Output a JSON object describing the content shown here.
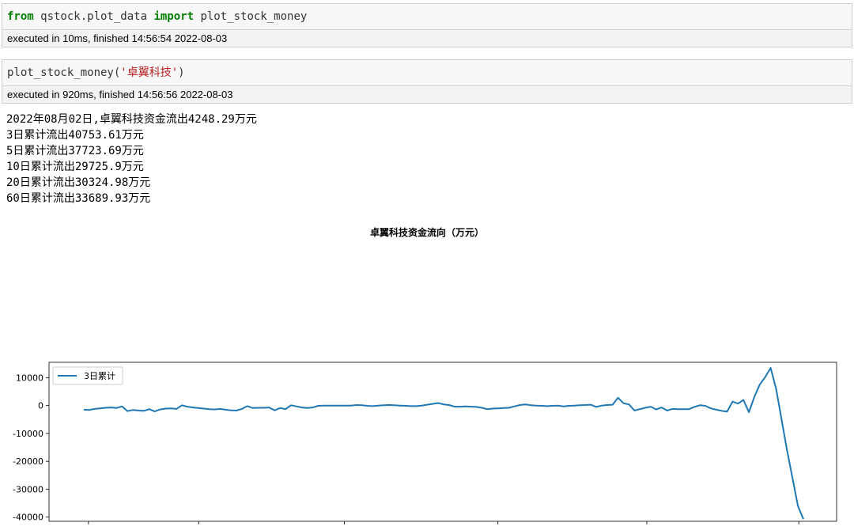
{
  "cells": [
    {
      "code_kw1": "from",
      "code_mod": " qstock.plot_data ",
      "code_kw2": "import",
      "code_rest": " plot_stock_money",
      "exec_text": "executed in 10ms, finished 14:56:54 2022-08-03"
    },
    {
      "code_fn": "plot_stock_money(",
      "code_str": "'卓翼科技'",
      "code_close": ")",
      "exec_text": "executed in 920ms, finished 14:56:56 2022-08-03"
    }
  ],
  "output_lines": [
    "2022年08月02日,卓翼科技资金流出4248.29万元",
    "3日累计流出40753.61万元",
    "5日累计流出37723.69万元",
    "10日累计流出29725.9万元",
    "20日累计流出30324.98万元",
    "60日累计流出33689.93万元"
  ],
  "colors": {
    "line": "#1f77b4",
    "keyword": "#008000",
    "string": "#ba2121"
  },
  "chart_data": {
    "type": "line",
    "title": "卓翼科技资金流向（万元）",
    "xlabel": "",
    "ylabel": "",
    "ylim": [
      -41500,
      15500
    ],
    "yticks": [
      10000,
      0,
      -10000,
      -20000,
      -30000,
      -40000
    ],
    "ytick_labels": [
      "10000",
      "0",
      "-10000",
      "-20000",
      "-30000",
      "-40000"
    ],
    "grid": false,
    "legend_position": "top-left",
    "series": [
      {
        "name": "3日累计",
        "values": [
          -1500,
          -1600,
          -1200,
          -1000,
          -800,
          -700,
          -900,
          -300,
          -2000,
          -1600,
          -1800,
          -1900,
          -1300,
          -2100,
          -1400,
          -1100,
          -1000,
          -1200,
          100,
          -400,
          -700,
          -900,
          -1100,
          -1300,
          -1400,
          -1200,
          -1500,
          -1700,
          -1800,
          -1200,
          -200,
          -900,
          -800,
          -800,
          -700,
          -1700,
          -900,
          -1300,
          100,
          -300,
          -700,
          -900,
          -700,
          -100,
          0,
          0,
          0,
          0,
          0,
          0,
          200,
          100,
          -100,
          -200,
          0,
          100,
          200,
          100,
          0,
          -100,
          -200,
          -200,
          0,
          300,
          600,
          900,
          400,
          200,
          -400,
          -400,
          -300,
          -400,
          -500,
          -800,
          -1300,
          -1100,
          -1000,
          -900,
          -800,
          -300,
          200,
          400,
          100,
          0,
          -100,
          -200,
          -100,
          0,
          -300,
          -100,
          0,
          100,
          200,
          300,
          -500,
          0,
          200,
          300,
          2800,
          800,
          400,
          -1800,
          -1300,
          -800,
          -400,
          -1400,
          -700,
          -1800,
          -1200,
          -1300,
          -1300,
          -1300,
          -500,
          100,
          -100,
          -1000,
          -1500,
          -1900,
          -2200,
          1400,
          700,
          2000,
          -2400,
          3100,
          7500,
          10200,
          13500,
          6000,
          -5000,
          -16000,
          -26000,
          -36000,
          -40700
        ]
      }
    ]
  }
}
